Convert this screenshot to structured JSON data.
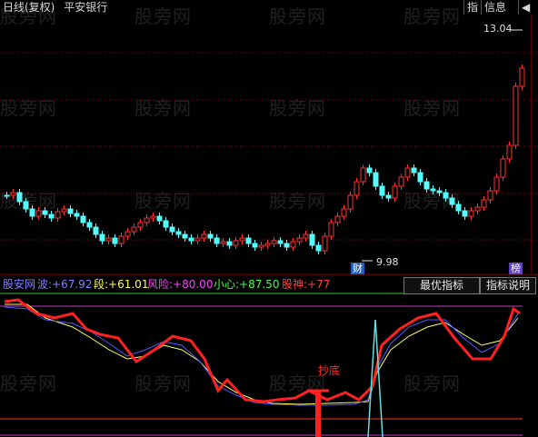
{
  "header": {
    "period": "日线(复权)",
    "stock": "平安银行"
  },
  "top_right": {
    "arrow_label": "指",
    "info_label": "信息",
    "prev_label": "◀"
  },
  "price_chart": {
    "high_label": "13.04",
    "low_label": "9.98",
    "cai_tag": "财",
    "bang_tag": "榜",
    "colors": {
      "up": "#ff3232",
      "down": "#54ffff",
      "grid": "#8b0000"
    }
  },
  "indicator": {
    "prefix": "股安网",
    "items": [
      {
        "label": "波:",
        "value": "+67.92",
        "color": "#7f7fff"
      },
      {
        "label": "段:",
        "value": "+61.01",
        "color": "#ffff60"
      },
      {
        "label": "风险:",
        "value": "+80.00",
        "color": "#ff40ff"
      },
      {
        "label": "小心:",
        "value": "+87.50",
        "color": "#40ff40"
      },
      {
        "label": "股神:",
        "value": "+77",
        "color": "#ff4040"
      }
    ],
    "best_button": "最优指标",
    "help_button": "指标说明",
    "bottom_label": "抄底"
  },
  "watermark": "股旁网"
}
